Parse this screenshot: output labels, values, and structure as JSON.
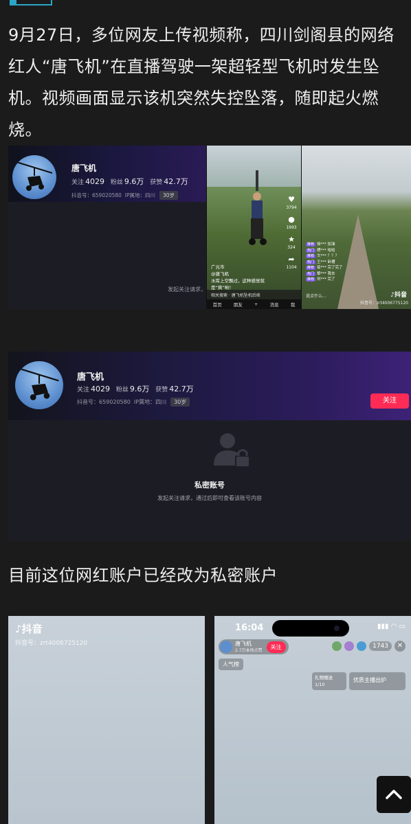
{
  "article": {
    "paragraph": "9月27日，多位网友上传视频称，四川剑阁县的网络红人“唐飞机”在直播驾驶一架超轻型飞机时发生坠机。视频画面显示该机突然失控坠落，随即起火燃烧。",
    "caption": "目前这位网红账户已经改为私密账户"
  },
  "profile": {
    "name": "唐飞机",
    "following_label": "关注",
    "following_value": "4029",
    "fans_label": "粉丝",
    "fans_value": "9.6万",
    "likes_label": "获赞",
    "likes_value": "42.7万",
    "douyin_id": "抖音号：659020580",
    "ip": "IP属地：四川",
    "age": "30岁",
    "follow_button": "关注",
    "private_title": "私密账号",
    "private_desc": "发起关注请求，通过后即可查看该账号内容",
    "follow_request_short": "发起关注请求，"
  },
  "video_mid": {
    "counts": [
      "3794",
      "1993",
      "324",
      "1104"
    ],
    "location": "广元市",
    "author": "@唐飞机",
    "caption": "水库上空飘过，这种感觉就是“爽”哟！",
    "related": "相关搜索 · 唐飞机坠机后续",
    "nav": [
      "首页",
      "朋友",
      "+",
      "消息",
      "我"
    ]
  },
  "video_right": {
    "comments": [
      {
        "tag": "推荐",
        "text": "徐*** 加油"
      },
      {
        "tag": "热门",
        "text": "楞*** 哈哈"
      },
      {
        "tag": "推荐",
        "text": "文*** ？？？"
      },
      {
        "tag": "热门",
        "text": "王*** 卧槽"
      },
      {
        "tag": "推荐",
        "text": "徒*** 完了完了"
      },
      {
        "tag": "热门",
        "text": "黎*** 我去"
      },
      {
        "tag": "推荐",
        "text": "刘*** 完了"
      }
    ],
    "say_something": "说点什么...",
    "tiktok_brand": "抖音",
    "tiktok_id": "抖音号：zrt4006775120"
  },
  "live_left": {
    "brand": "抖音",
    "id": "抖音号：zrt4006725120"
  },
  "live_right": {
    "time": "16:04",
    "streamer": "唐飞机",
    "streamer_sub": "2.7万本场点赞",
    "follow": "关注",
    "viewer_count": "1743",
    "popularity": "人气榜",
    "task1_title": "礼物赠送",
    "task1_value": "1/10",
    "task2": "优质主播出炉"
  },
  "colors": {
    "accent": "#fe2c55",
    "page_bg": "#1b1b1b",
    "top_accent": "#2aa6c8"
  }
}
